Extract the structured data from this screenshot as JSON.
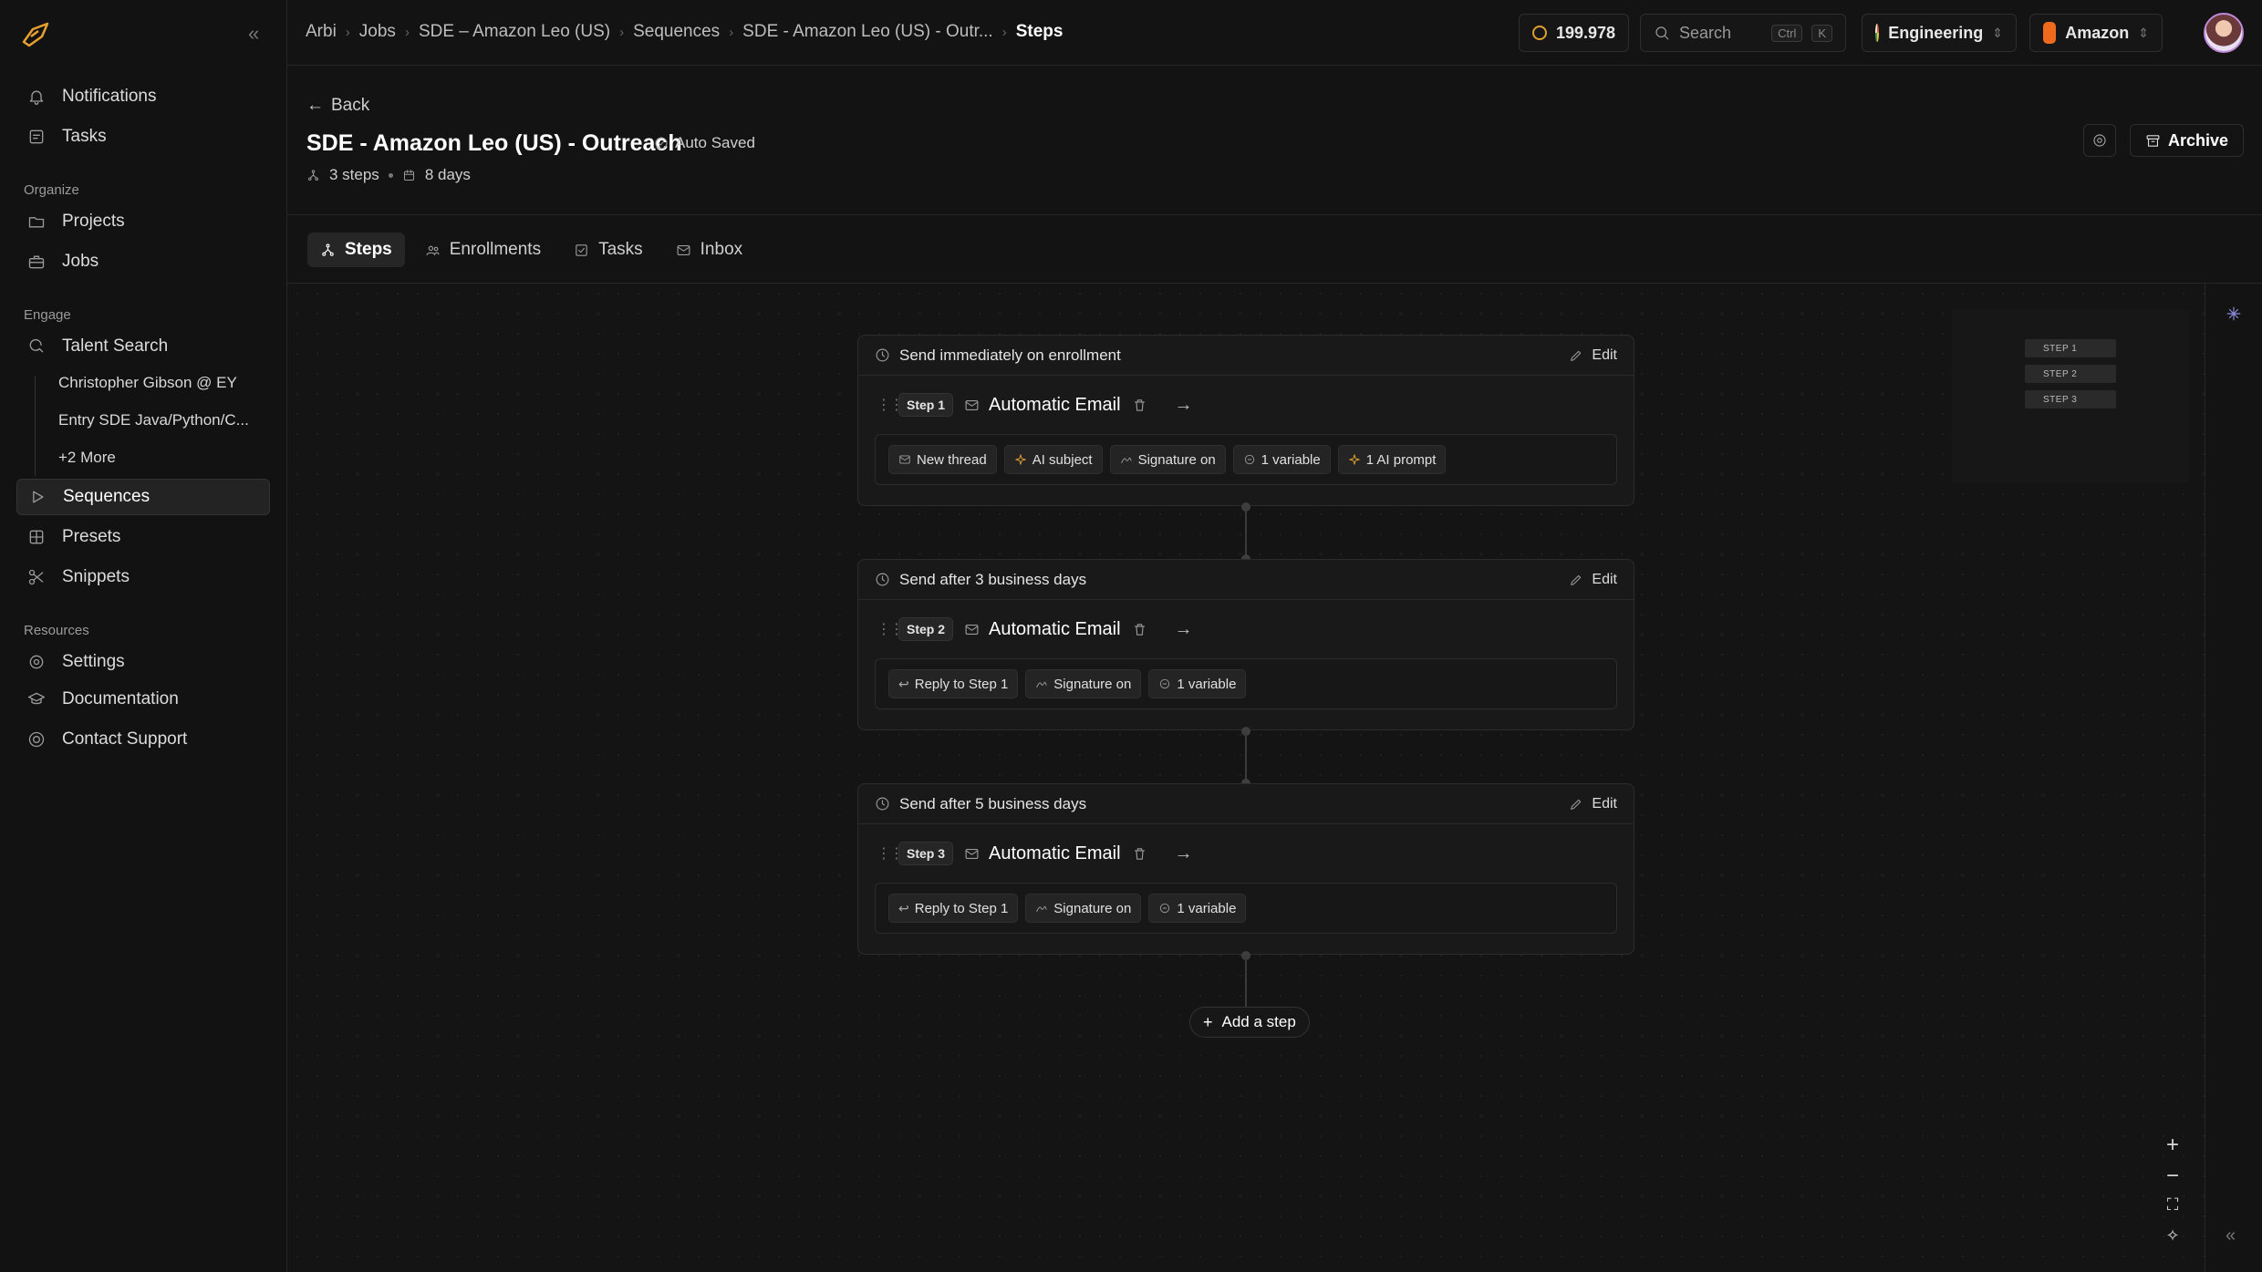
{
  "sidebar": {
    "top_items": [
      {
        "label": "Notifications",
        "icon": "bell-icon"
      },
      {
        "label": "Tasks",
        "icon": "checklist-icon"
      }
    ],
    "sections": {
      "organize": "Organize",
      "engage": "Engage",
      "resources": "Resources"
    },
    "organize_items": [
      {
        "label": "Projects",
        "icon": "folder-icon"
      },
      {
        "label": "Jobs",
        "icon": "briefcase-icon"
      }
    ],
    "engage_items": {
      "talent_search": "Talent Search",
      "saved_searches": [
        "Christopher Gibson @ EY",
        "Entry SDE Java/Python/C..."
      ],
      "more": "+2 More",
      "sequences": "Sequences",
      "presets": "Presets",
      "snippets": "Snippets"
    },
    "resource_items": [
      {
        "label": "Settings",
        "icon": "gear-icon"
      },
      {
        "label": "Documentation",
        "icon": "graduation-cap-icon"
      },
      {
        "label": "Contact Support",
        "icon": "lifebuoy-icon"
      }
    ]
  },
  "topbar": {
    "breadcrumbs": [
      "Arbi",
      "Jobs",
      "SDE – Amazon Leo (US)",
      "Sequences",
      "SDE - Amazon Leo (US) - Outr..."
    ],
    "current": "Steps",
    "credits": "199.978",
    "search_placeholder": "Search",
    "kbd_ctrl": "Ctrl",
    "kbd_k": "K",
    "team": "Engineering",
    "company": "Amazon"
  },
  "page": {
    "back": "Back",
    "title": "SDE - Amazon Leo (US) - Outreach",
    "status": "Auto Saved",
    "steps_count": "3 steps",
    "duration": "8 days",
    "archive": "Archive"
  },
  "tabs": [
    "Steps",
    "Enrollments",
    "Tasks",
    "Inbox"
  ],
  "edit_label": "Edit",
  "steps": [
    {
      "timing": "Send immediately on enrollment",
      "badge": "Step 1",
      "type": "Automatic Email",
      "chips": [
        "New thread",
        "AI subject",
        "Signature on",
        "1 variable",
        "1 AI prompt"
      ]
    },
    {
      "timing": "Send after 3 business days",
      "badge": "Step 2",
      "type": "Automatic Email",
      "chips": [
        "Reply to Step 1",
        "Signature on",
        "1 variable"
      ]
    },
    {
      "timing": "Send after 5 business days",
      "badge": "Step 3",
      "type": "Automatic Email",
      "chips": [
        "Reply to Step 1",
        "Signature on",
        "1 variable"
      ]
    }
  ],
  "add_step": "Add a step",
  "minimap": [
    "STEP 1",
    "STEP 2",
    "STEP 3"
  ],
  "colors": {
    "accent_orange": "#e0a030",
    "brand_orange": "#f06a1e",
    "background": "#131313"
  }
}
